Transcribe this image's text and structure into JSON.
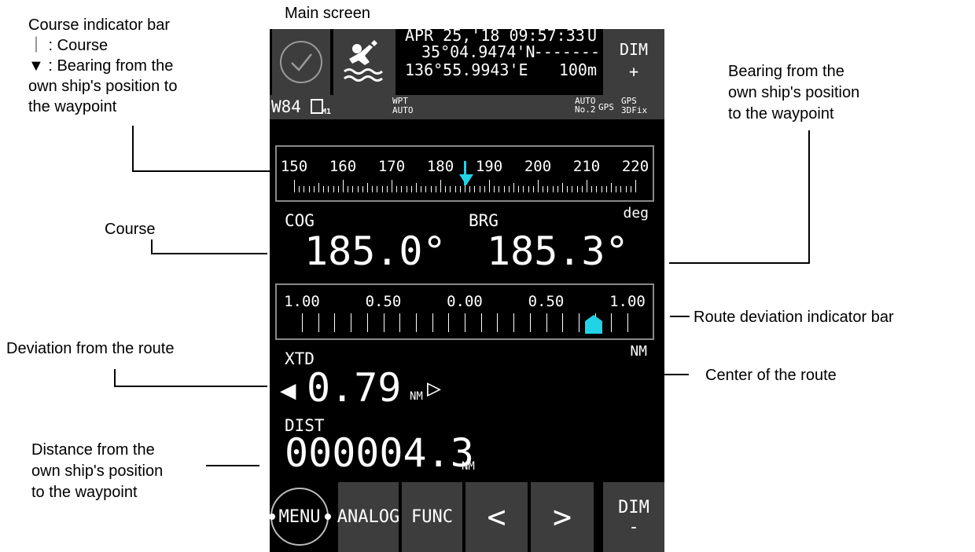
{
  "annotations": {
    "main_screen": "Main screen",
    "course_indicator_bar": "Course indicator bar",
    "course_legend": "｜ : Course",
    "bearing_legend_1": "▼ : Bearing from the",
    "bearing_legend_2": "own ship's position to",
    "bearing_legend_3": "the waypoint",
    "course": "Course",
    "deviation": "Deviation from the route",
    "distance_1": "Distance from the",
    "distance_2": "own ship's position",
    "distance_3": "to the waypoint",
    "bearing_1": "Bearing from the",
    "bearing_2": "own ship's position",
    "bearing_3": "to the waypoint",
    "route_dev_bar": "Route deviation indicator bar",
    "center_route": "Center of the route"
  },
  "header": {
    "datetime": "APR 25,'18 09:57:33",
    "time_flag": "U",
    "lat": "35°04.9474'N",
    "lat_dash": "-------",
    "lon": "136°55.9943'E",
    "alt": "100m",
    "dim_top": "DIM",
    "dim_top_sign": "+",
    "check_icon": "check-circle",
    "mob_icon": "man-overboard"
  },
  "status": {
    "datum": "W84",
    "mem": "M1",
    "wpt": "WPT",
    "wpt_mode": "AUTO",
    "auto": "AUTO",
    "no": "No.2",
    "gps": "GPS",
    "gps2": "GPS",
    "fix": "3DFix"
  },
  "compass": {
    "labels": [
      "150",
      "160",
      "170",
      "180",
      "190",
      "200",
      "210",
      "220"
    ],
    "course_deg": 185.0,
    "bearing_deg": 185.3,
    "accent": "#22d3e6"
  },
  "readouts": {
    "deg_unit": "deg",
    "cog_label": "COG",
    "brg_label": "BRG",
    "cog_value": "185.0°",
    "brg_value": "185.3°"
  },
  "xtd_bar": {
    "labels": [
      "1.00",
      "0.50",
      "0.00",
      "0.50",
      "1.00"
    ],
    "unit": "NM",
    "xtd_value_nm": 0.79
  },
  "xtd": {
    "label": "XTD",
    "left_arrow": "◀",
    "value": "0.79",
    "unit": "NM",
    "right_arrow": "▷"
  },
  "dist": {
    "label": "DIST",
    "value": "000004.3",
    "unit": "NM"
  },
  "bottom": {
    "menu": "MENU",
    "analog": "ANALOG",
    "func": "FUNC",
    "prev": "<",
    "next": ">",
    "dim": "DIM",
    "dim_sign": "-"
  }
}
